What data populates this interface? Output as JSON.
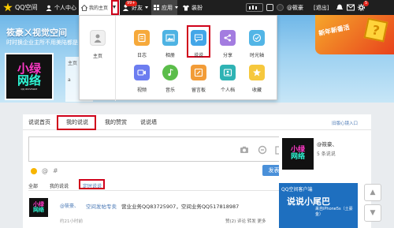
{
  "topbar": {
    "brand": "QQ空间",
    "personal_center": "个人中心",
    "my_home": "我的主页",
    "friends": "好友",
    "friends_badge": "99+",
    "apps": "应用",
    "extras": "装扮",
    "user": "@筱豪",
    "logout": "[退出]",
    "mail_badge": "5"
  },
  "banner": {
    "space_title": "筱豪ㄨ视觉空间",
    "space_sub": "时时换企业主所不用美陆都是",
    "nav_home": "主页",
    "nav_at": "a"
  },
  "promo": {
    "text": "新年新番活"
  },
  "dropdown": {
    "home_label": "主页",
    "apps": [
      {
        "label": "日志"
      },
      {
        "label": "相册"
      },
      {
        "label": "说说"
      },
      {
        "label": "分享"
      },
      {
        "label": "时光轴"
      },
      {
        "label": "视频"
      },
      {
        "label": "音乐"
      },
      {
        "label": "留言板"
      },
      {
        "label": "个人档"
      },
      {
        "label": "收藏"
      }
    ]
  },
  "tabs": {
    "all": "说说首页",
    "mine": "我的说说",
    "likes": "我的赞赏",
    "wall": "说说墙",
    "switch": "旧版心镜入口"
  },
  "composer": {
    "post": "发表"
  },
  "filter": {
    "all": "全部",
    "mine": "我的说说",
    "timed": "定时说说"
  },
  "feed": {
    "author": "@筱豪、",
    "title": "空间发帖专卖",
    "content": "营业业务QQ83725907，空间业务QQ517818987",
    "time": "约21小时前",
    "actions": "赞(2) 评论 转发 更多"
  },
  "profile": {
    "name": "@筱豪、",
    "stat": "5 条说说"
  },
  "client": {
    "header": "QQ空间客户端",
    "slogan": "说说小尾巴",
    "sub": "来自iPhone5s（土豪金）"
  },
  "avatar_text": {
    "line1": "小绿",
    "line2": "网络",
    "line3": "QQ 83725907"
  }
}
